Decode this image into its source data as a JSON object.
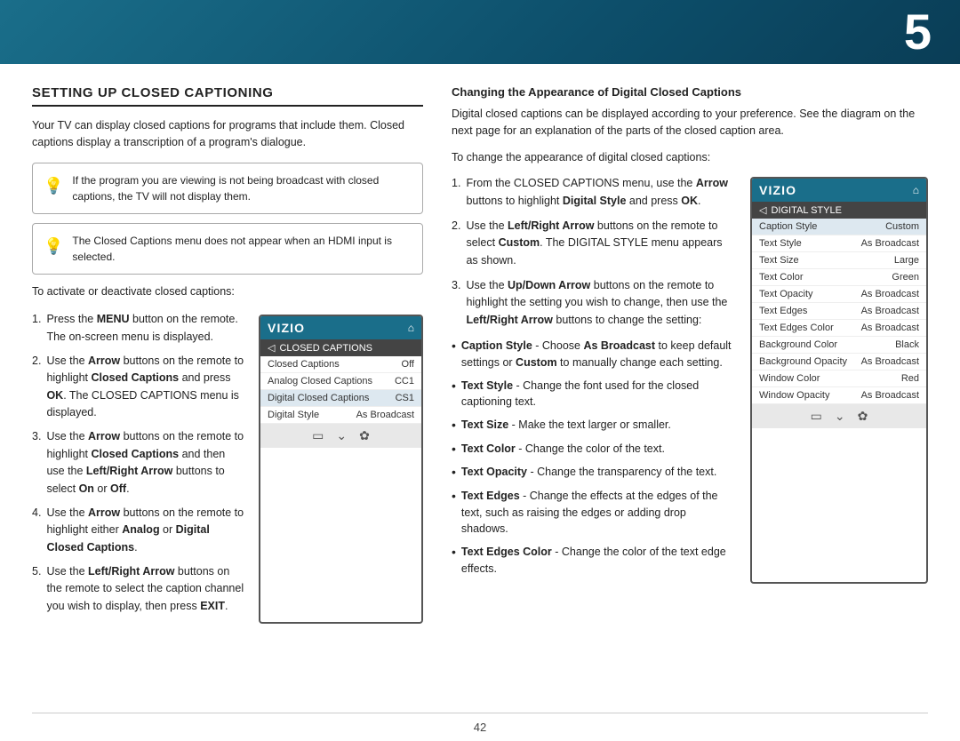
{
  "page": {
    "number": "5",
    "page_num_display": "42"
  },
  "left": {
    "title": "SETTING UP CLOSED CAPTIONING",
    "intro": "Your TV can display closed captions for programs that include them. Closed captions display a transcription of a program's dialogue.",
    "tip1": "If the program you are viewing is not being broadcast with closed captions, the TV will not display them.",
    "tip2": "The Closed Captions menu does not appear when an HDMI input is selected.",
    "activate_label": "To activate or deactivate closed captions:",
    "steps": [
      {
        "num": "1.",
        "text": "Press the MENU button on the remote. The on-screen menu is displayed."
      },
      {
        "num": "2.",
        "text": "Use the Arrow buttons on the remote to highlight Closed Captions and press OK. The CLOSED CAPTIONS menu is displayed."
      },
      {
        "num": "3.",
        "text": "Use the Arrow buttons on the remote to highlight Closed Captions and then use the Left/Right Arrow buttons to select On or Off."
      },
      {
        "num": "4.",
        "text": "Use the Arrow buttons on the remote to highlight either Analog or Digital Closed Captions."
      },
      {
        "num": "5.",
        "text": "Use the Left/Right Arrow buttons on the remote to select the caption channel you wish to display, then press EXIT."
      }
    ],
    "menu": {
      "logo": "VIZIO",
      "section": "CLOSED CAPTIONS",
      "rows": [
        {
          "label": "Closed Captions",
          "value": "Off"
        },
        {
          "label": "Analog Closed Captions",
          "value": "CC1"
        },
        {
          "label": "Digital Closed Captions",
          "value": "CS1"
        },
        {
          "label": "Digital Style",
          "value": "As Broadcast"
        }
      ],
      "footer_icons": [
        "▬",
        "⌄",
        "✿"
      ]
    }
  },
  "right": {
    "title": "Changing the Appearance of Digital Closed Captions",
    "intro1": "Digital closed captions can be displayed according to your preference. See the diagram on the next page for an explanation of the parts of the closed caption area.",
    "intro2": "To change the appearance of digital closed captions:",
    "steps": [
      {
        "num": "1.",
        "text_parts": [
          "From the CLOSED CAPTIONS menu, use the ",
          "Arrow",
          " buttons to highlight ",
          "Digital Style",
          " and press ",
          "OK",
          "."
        ]
      },
      {
        "num": "2.",
        "text_parts": [
          "Use the ",
          "Left/Right Arrow",
          " buttons on the remote to select ",
          "Custom",
          ". The DIGITAL STYLE menu appears as shown."
        ]
      },
      {
        "num": "3.",
        "text_parts": [
          "Use the ",
          "Up/Down Arrow",
          " buttons on the remote to highlight the setting you wish to change, then use the ",
          "Left/Right Arrow",
          " buttons to change the setting:"
        ]
      }
    ],
    "menu": {
      "logo": "VIZIO",
      "section": "DIGITAL STYLE",
      "rows": [
        {
          "label": "Caption Style",
          "value": "Custom"
        },
        {
          "label": "Text Style",
          "value": "As Broadcast"
        },
        {
          "label": "Text Size",
          "value": "Large"
        },
        {
          "label": "Text Color",
          "value": "Green"
        },
        {
          "label": "Text Opacity",
          "value": "As Broadcast"
        },
        {
          "label": "Text Edges",
          "value": "As Broadcast"
        },
        {
          "label": "Text Edges Color",
          "value": "As Broadcast"
        },
        {
          "label": "Background Color",
          "value": "Black"
        },
        {
          "label": "Background Opacity",
          "value": "As Broadcast"
        },
        {
          "label": "Window Color",
          "value": "Red"
        },
        {
          "label": "Window Opacity",
          "value": "As Broadcast"
        }
      ],
      "footer_icons": [
        "▬",
        "⌄",
        "✿"
      ]
    },
    "bullets": [
      {
        "key": "Caption Style",
        "text": " - Choose As Broadcast to keep default settings or Custom to manually change each setting."
      },
      {
        "key": "Text Style",
        "text": "  - Change the font used for the closed captioning text."
      },
      {
        "key": "Text Size",
        "text": " - Make the text larger or smaller."
      },
      {
        "key": "Text Color",
        "text": " - Change the color of the text."
      },
      {
        "key": "Text Opacity",
        "text": " - Change the transparency of the text."
      },
      {
        "key": "Text Edges",
        "text": " - Change the effects at the edges of the text, such as raising the edges or adding drop shadows."
      },
      {
        "key": "Text Edges Color",
        "text": " - Change the color of the text edge effects."
      }
    ]
  }
}
